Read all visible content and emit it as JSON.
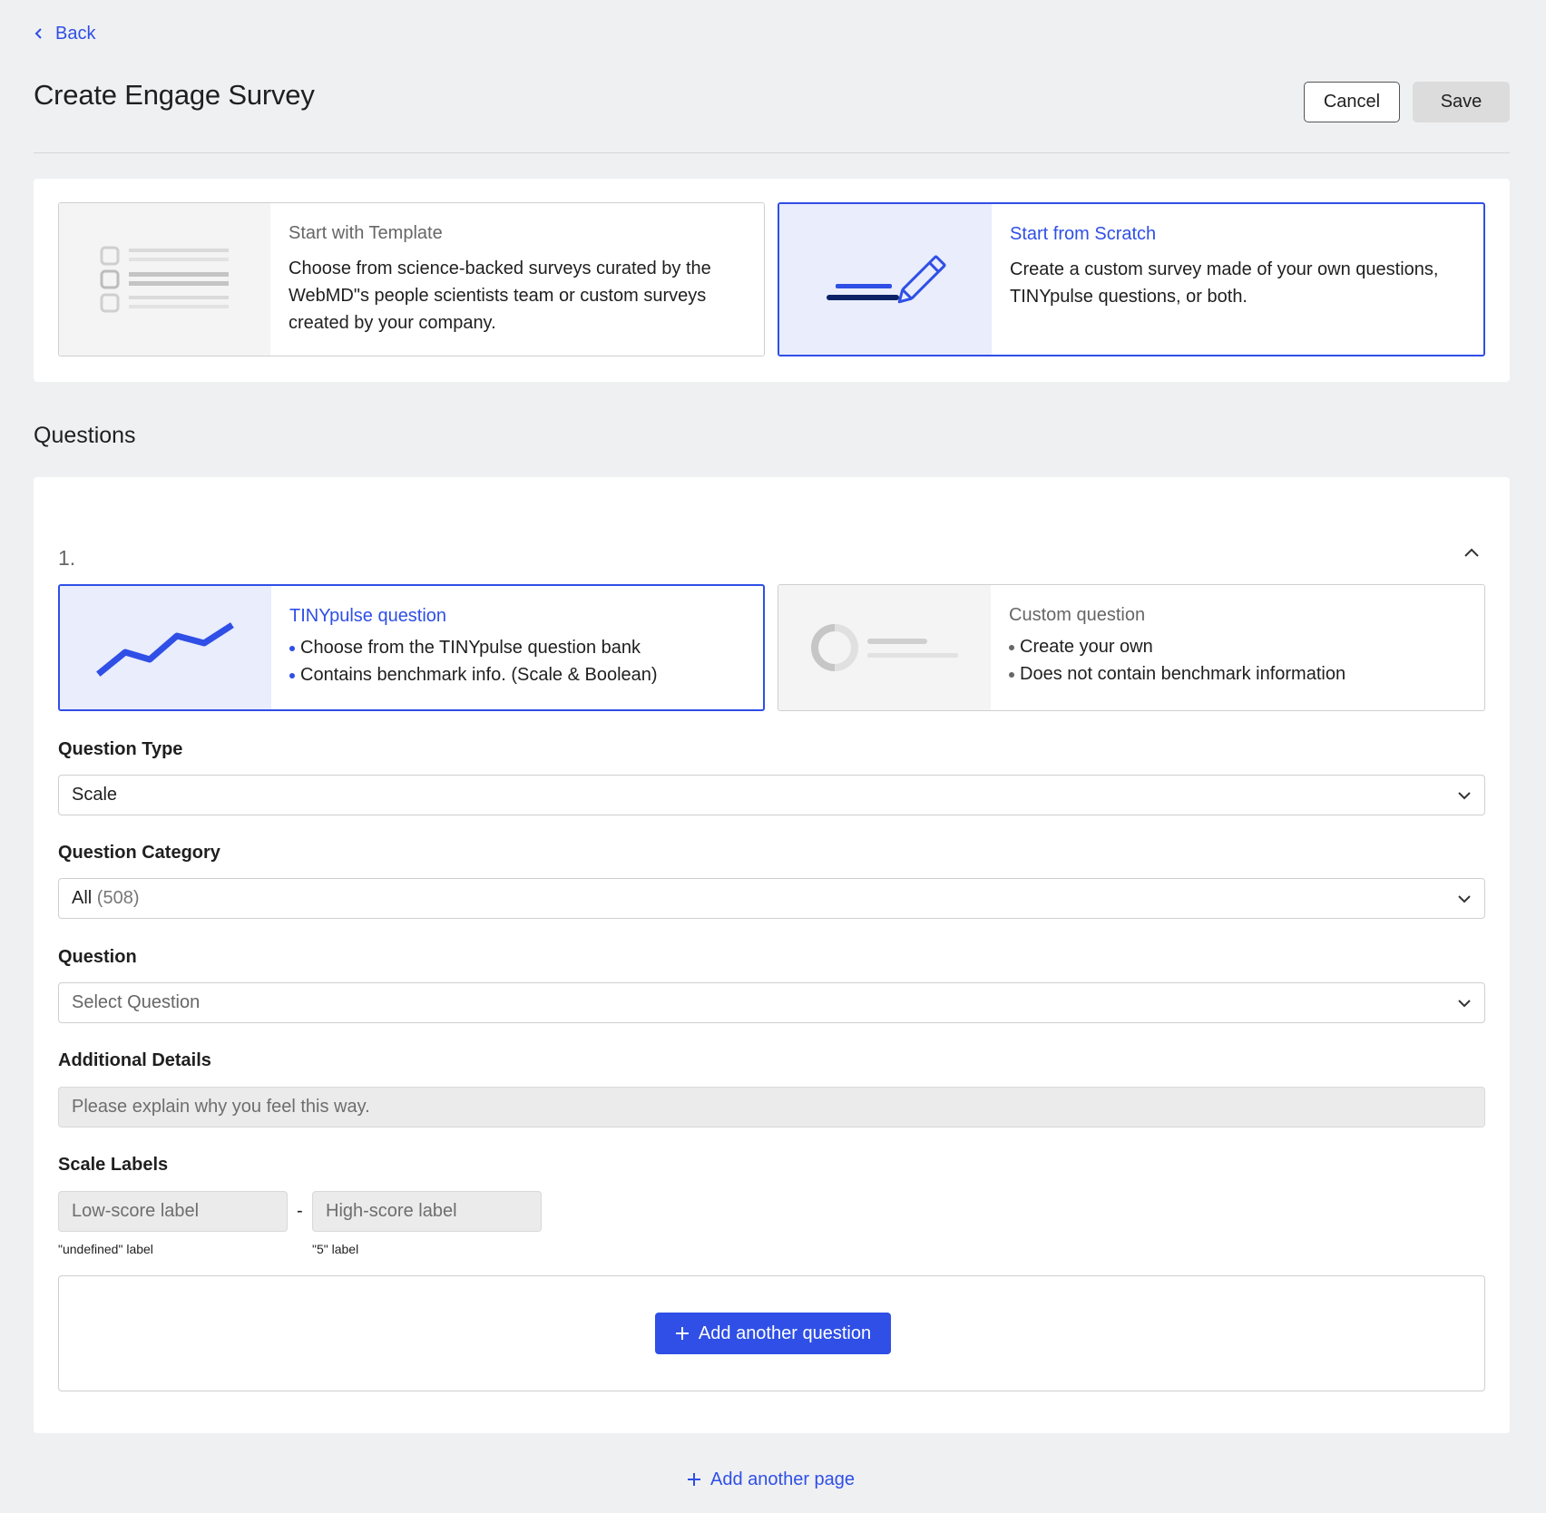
{
  "nav": {
    "back_label": "Back"
  },
  "header": {
    "title": "Create Engage Survey",
    "cancel_label": "Cancel",
    "save_label": "Save"
  },
  "start_options": {
    "template": {
      "title": "Start with Template",
      "description": "Choose from science-backed surveys curated by the WebMD\"s people scientists team or custom surveys created by your company.",
      "selected": false
    },
    "scratch": {
      "title": "Start from Scratch",
      "description": "Create a custom survey made of your own questions, TINYpulse questions, or both.",
      "selected": true
    }
  },
  "questions_section": {
    "title": "Questions",
    "question": {
      "number": "1.",
      "source_options": {
        "tinypulse": {
          "title": "TINYpulse question",
          "bullets": [
            "Choose from the TINYpulse question bank",
            "Contains benchmark info. (Scale & Boolean)"
          ],
          "selected": true
        },
        "custom": {
          "title": "Custom question",
          "bullets": [
            "Create your own",
            "Does not contain benchmark information"
          ],
          "selected": false
        }
      },
      "question_type": {
        "label": "Question Type",
        "value": "Scale"
      },
      "question_category": {
        "label": "Question Category",
        "value": "All",
        "count": "(508)"
      },
      "question": {
        "label": "Question",
        "placeholder": "Select Question"
      },
      "additional_details": {
        "label": "Additional Details",
        "placeholder": "Please explain why you feel this way."
      },
      "scale_labels": {
        "label": "Scale Labels",
        "low_placeholder": "Low-score label",
        "high_placeholder": "High-score label",
        "separator": "-",
        "low_hint": "\"undefined\" label",
        "high_hint": "\"5\" label"
      }
    },
    "add_question_label": "Add another question"
  },
  "add_page_label": "Add another page",
  "colors": {
    "accent": "#2f4fe6",
    "background": "#eff0f2",
    "selected_art_bg": "#e9edfc"
  }
}
